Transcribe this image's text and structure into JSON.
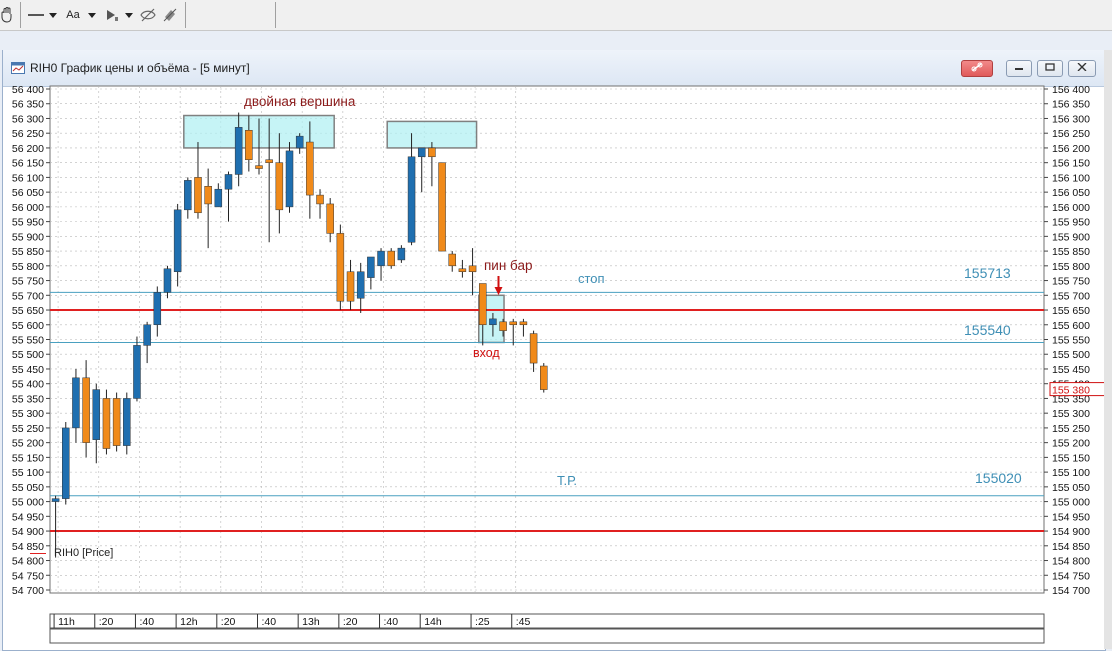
{
  "toolbar": {
    "text_tool_label": "Aa"
  },
  "window": {
    "title": "RIH0 График цены и объёма - [5 минут]"
  },
  "legend": {
    "series_label": "RIH0 [Price]"
  },
  "colors": {
    "bull": "#1f6fb0",
    "bear": "#f08a1a",
    "grid": "#b8b8b8",
    "red_line": "#e02020",
    "blue_line": "#4aa0c0",
    "zone_fill": "#aef0f2",
    "annotation_dark": "#8b1a1a",
    "annotation_blue": "#3f8fb5"
  },
  "chart_data": {
    "type": "candlestick",
    "ylim": [
      54700,
      56400
    ],
    "y_ticks": [
      "56 400",
      "56 350",
      "56 300",
      "56 250",
      "56 200",
      "56 150",
      "56 100",
      "56 050",
      "56 000",
      "55 950",
      "55 900",
      "55 850",
      "55 800",
      "55 750",
      "55 700",
      "55 650",
      "55 600",
      "55 550",
      "55 500",
      "55 450",
      "55 400",
      "55 350",
      "55 300",
      "55 250",
      "55 200",
      "55 150",
      "55 100",
      "55 050",
      "55 000",
      "54 950",
      "54 900",
      "54 850",
      "54 800",
      "54 750",
      "54 700"
    ],
    "y_ticks_right": [
      "156 400",
      "156 350",
      "156 300",
      "156 250",
      "156 200",
      "156 150",
      "156 100",
      "156 050",
      "156 000",
      "155 950",
      "155 900",
      "155 850",
      "155 800",
      "155 750",
      "155 700",
      "155 650",
      "155 600",
      "155 550",
      "155 500",
      "155 450",
      "155 400",
      "155 350",
      "155 300",
      "155 250",
      "155 200",
      "155 150",
      "155 100",
      "155 050",
      "155 000",
      "154 950",
      "154 900",
      "154 850",
      "154 800",
      "154 750",
      "154 700"
    ],
    "time_labels": [
      {
        "label": "11h",
        "bar": 0.5
      },
      {
        "label": ":20",
        "bar": 4.5
      },
      {
        "label": ":40",
        "bar": 8.5
      },
      {
        "label": "12h",
        "bar": 12.5
      },
      {
        "label": ":20",
        "bar": 16.5
      },
      {
        "label": ":40",
        "bar": 20.5
      },
      {
        "label": "13h",
        "bar": 24.5
      },
      {
        "label": ":20",
        "bar": 28.5
      },
      {
        "label": ":40",
        "bar": 32.5
      },
      {
        "label": "14h",
        "bar": 36.5
      },
      {
        "label": ":25",
        "bar": 41.5
      },
      {
        "label": ":45",
        "bar": 45.5
      }
    ],
    "candles": [
      {
        "o": 55000,
        "h": 55020,
        "l": 54810,
        "c": 55010
      },
      {
        "o": 55010,
        "h": 55270,
        "l": 54990,
        "c": 55250
      },
      {
        "o": 55250,
        "h": 55450,
        "l": 55200,
        "c": 55420
      },
      {
        "o": 55420,
        "h": 55480,
        "l": 55150,
        "c": 55200
      },
      {
        "o": 55210,
        "h": 55400,
        "l": 55130,
        "c": 55380
      },
      {
        "o": 55350,
        "h": 55380,
        "l": 55160,
        "c": 55180
      },
      {
        "o": 55350,
        "h": 55370,
        "l": 55170,
        "c": 55190
      },
      {
        "o": 55190,
        "h": 55370,
        "l": 55160,
        "c": 55350
      },
      {
        "o": 55350,
        "h": 55560,
        "l": 55340,
        "c": 55530
      },
      {
        "o": 55530,
        "h": 55610,
        "l": 55470,
        "c": 55600
      },
      {
        "o": 55600,
        "h": 55730,
        "l": 55560,
        "c": 55710
      },
      {
        "o": 55710,
        "h": 55800,
        "l": 55690,
        "c": 55790
      },
      {
        "o": 55780,
        "h": 56010,
        "l": 55730,
        "c": 55990
      },
      {
        "o": 55990,
        "h": 56100,
        "l": 55960,
        "c": 56090
      },
      {
        "o": 56100,
        "h": 56220,
        "l": 55960,
        "c": 55980
      },
      {
        "o": 56070,
        "h": 56130,
        "l": 55860,
        "c": 56010
      },
      {
        "o": 56000,
        "h": 56080,
        "l": 56000,
        "c": 56060
      },
      {
        "o": 56060,
        "h": 56120,
        "l": 55950,
        "c": 56110
      },
      {
        "o": 56110,
        "h": 56320,
        "l": 56070,
        "c": 56270
      },
      {
        "o": 56260,
        "h": 56310,
        "l": 56120,
        "c": 56160
      },
      {
        "o": 56140,
        "h": 56300,
        "l": 56110,
        "c": 56130
      },
      {
        "o": 56160,
        "h": 56300,
        "l": 55880,
        "c": 56150
      },
      {
        "o": 56150,
        "h": 56250,
        "l": 55910,
        "c": 55990
      },
      {
        "o": 56000,
        "h": 56220,
        "l": 55980,
        "c": 56190
      },
      {
        "o": 56200,
        "h": 56250,
        "l": 56180,
        "c": 56240
      },
      {
        "o": 56220,
        "h": 56290,
        "l": 55960,
        "c": 56040
      },
      {
        "o": 56040,
        "h": 56060,
        "l": 55960,
        "c": 56010
      },
      {
        "o": 56010,
        "h": 56030,
        "l": 55880,
        "c": 55910
      },
      {
        "o": 55910,
        "h": 55940,
        "l": 55650,
        "c": 55680
      },
      {
        "o": 55780,
        "h": 55820,
        "l": 55650,
        "c": 55680
      },
      {
        "o": 55690,
        "h": 55810,
        "l": 55640,
        "c": 55780
      },
      {
        "o": 55760,
        "h": 55820,
        "l": 55720,
        "c": 55830
      },
      {
        "o": 55800,
        "h": 55860,
        "l": 55750,
        "c": 55850
      },
      {
        "o": 55850,
        "h": 55860,
        "l": 55790,
        "c": 55800
      },
      {
        "o": 55820,
        "h": 55870,
        "l": 55810,
        "c": 55860
      },
      {
        "o": 55880,
        "h": 56250,
        "l": 55870,
        "c": 56170
      },
      {
        "o": 56170,
        "h": 56180,
        "l": 56050,
        "c": 56200
      },
      {
        "o": 56200,
        "h": 56220,
        "l": 56070,
        "c": 56170
      },
      {
        "o": 56150,
        "h": 56150,
        "l": 55850,
        "c": 55850
      },
      {
        "o": 55840,
        "h": 55850,
        "l": 55780,
        "c": 55800
      },
      {
        "o": 55790,
        "h": 55820,
        "l": 55760,
        "c": 55780
      },
      {
        "o": 55800,
        "h": 55860,
        "l": 55700,
        "c": 55780
      },
      {
        "o": 55740,
        "h": 55740,
        "l": 55530,
        "c": 55600
      },
      {
        "o": 55600,
        "h": 55640,
        "l": 55560,
        "c": 55620
      },
      {
        "o": 55610,
        "h": 55620,
        "l": 55560,
        "c": 55580
      },
      {
        "o": 55610,
        "h": 55620,
        "l": 55530,
        "c": 55600
      },
      {
        "o": 55610,
        "h": 55620,
        "l": 55560,
        "c": 55600
      },
      {
        "o": 55570,
        "h": 55580,
        "l": 55440,
        "c": 55470
      },
      {
        "o": 55460,
        "h": 55470,
        "l": 55370,
        "c": 55380
      }
    ],
    "annotations": {
      "double_top_label": "двойная вершина",
      "pin_bar_label": "пин бар",
      "stop_label": "стоп",
      "stop_value": "155713",
      "entry_label": "вход",
      "entry_value": "155540",
      "tp_label": "Т.Р.",
      "tp_value": "155020",
      "last_price": "155 380"
    },
    "levels": {
      "stop": 55710,
      "red_upper": 55650,
      "entry": 55540,
      "tp": 55020,
      "red_lower": 54900
    },
    "zones": [
      {
        "from_bar": 13,
        "to_bar": 27,
        "low": 56200,
        "high": 56310
      },
      {
        "from_bar": 33,
        "to_bar": 41,
        "low": 56200,
        "high": 56290
      },
      {
        "from_bar": 42,
        "to_bar": 43.7,
        "low": 55540,
        "high": 55700
      }
    ],
    "grid": true
  }
}
